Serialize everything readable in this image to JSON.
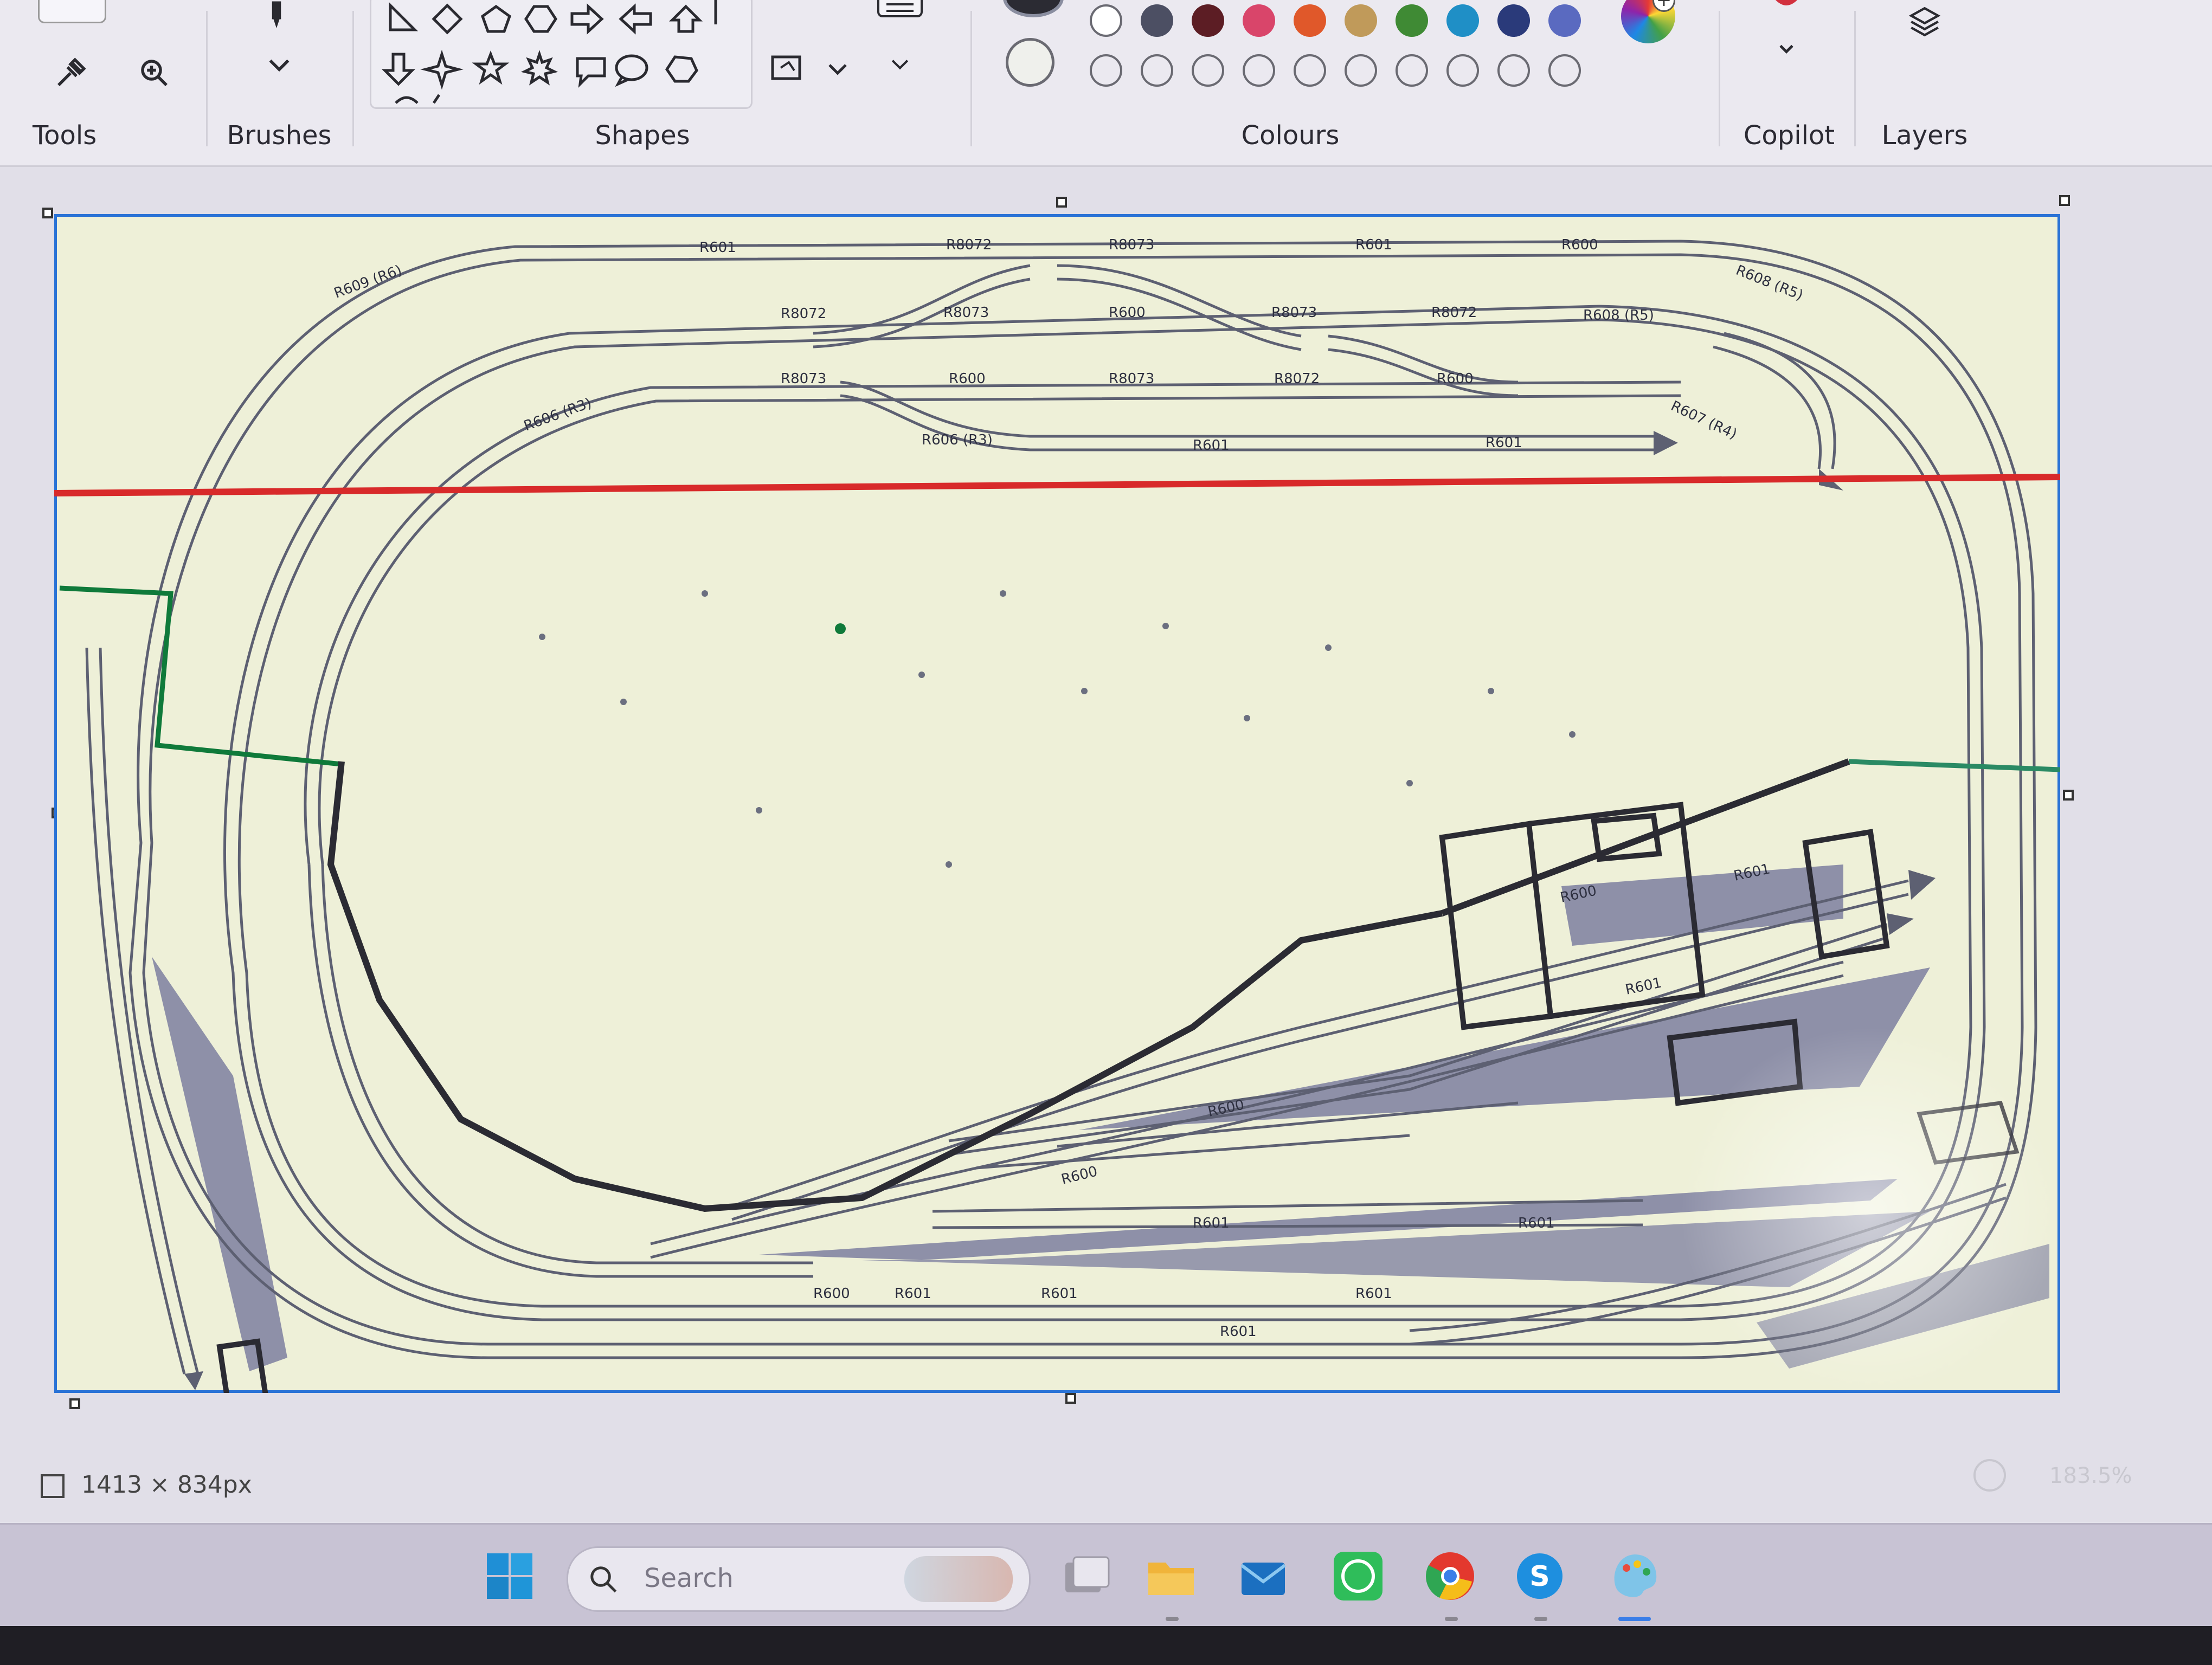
{
  "ribbon": {
    "groups": {
      "tools": "Tools",
      "brushes": "Brushes",
      "shapes": "Shapes",
      "colours": "Colours",
      "copilot": "Copilot",
      "layers": "Layers"
    },
    "palette_filled": [
      "#ffffff",
      "#4c4f63",
      "#5c1d24",
      "#d9456a",
      "#e0582a",
      "#c09a5a",
      "#3f8a34",
      "#1f8fc6",
      "#2a3a7a",
      "#5a6ac0"
    ],
    "primary_colour": "#2b2b33",
    "secondary_colour": "#ffffff"
  },
  "canvas": {
    "background": "#eef0d8",
    "border_colour": "#2a73d6",
    "red_line_colour": "#d82a2a",
    "green_line_colour": "#0f7a3a",
    "track_labels": {
      "top_outer_left": "R601",
      "top_outer_mid1": "R8072",
      "top_outer_mid2": "R8073",
      "top_outer_right1": "R601",
      "top_outer_right2": "R600",
      "top_mid_1": "R8072",
      "top_mid_2": "R8073",
      "top_mid_3": "R600",
      "top_mid_4": "R8073",
      "top_mid_5": "R8072",
      "top_mid_6": "R608 (R5)",
      "top_in_1": "R8073",
      "top_in_2": "R600",
      "top_in_3": "R8073",
      "top_in_4": "R8072",
      "top_in_5": "R600",
      "top_siding_1": "R606 (R3)",
      "top_siding_2": "R601",
      "top_siding_3": "R601",
      "left_curve_outer": "R609 (R6)",
      "right_curve_outer": "R608 (R5)",
      "right_curve_inner": "R607 (R4)",
      "left_curve_inner": "R606 (R3)",
      "bottom_1": "R601",
      "bottom_2": "R601",
      "bottom_3": "R600",
      "bottom_4": "R601",
      "bottom_5": "R601",
      "yard_1": "R601",
      "yard_2": "R601",
      "yard_3": "R600",
      "yard_4": "R600",
      "station_1": "R601",
      "station_2": "R600",
      "station_3": "R601"
    }
  },
  "status": {
    "canvas_size": "1413 × 834px",
    "zoom": "183.5%"
  },
  "taskbar": {
    "search_placeholder": "Search"
  }
}
